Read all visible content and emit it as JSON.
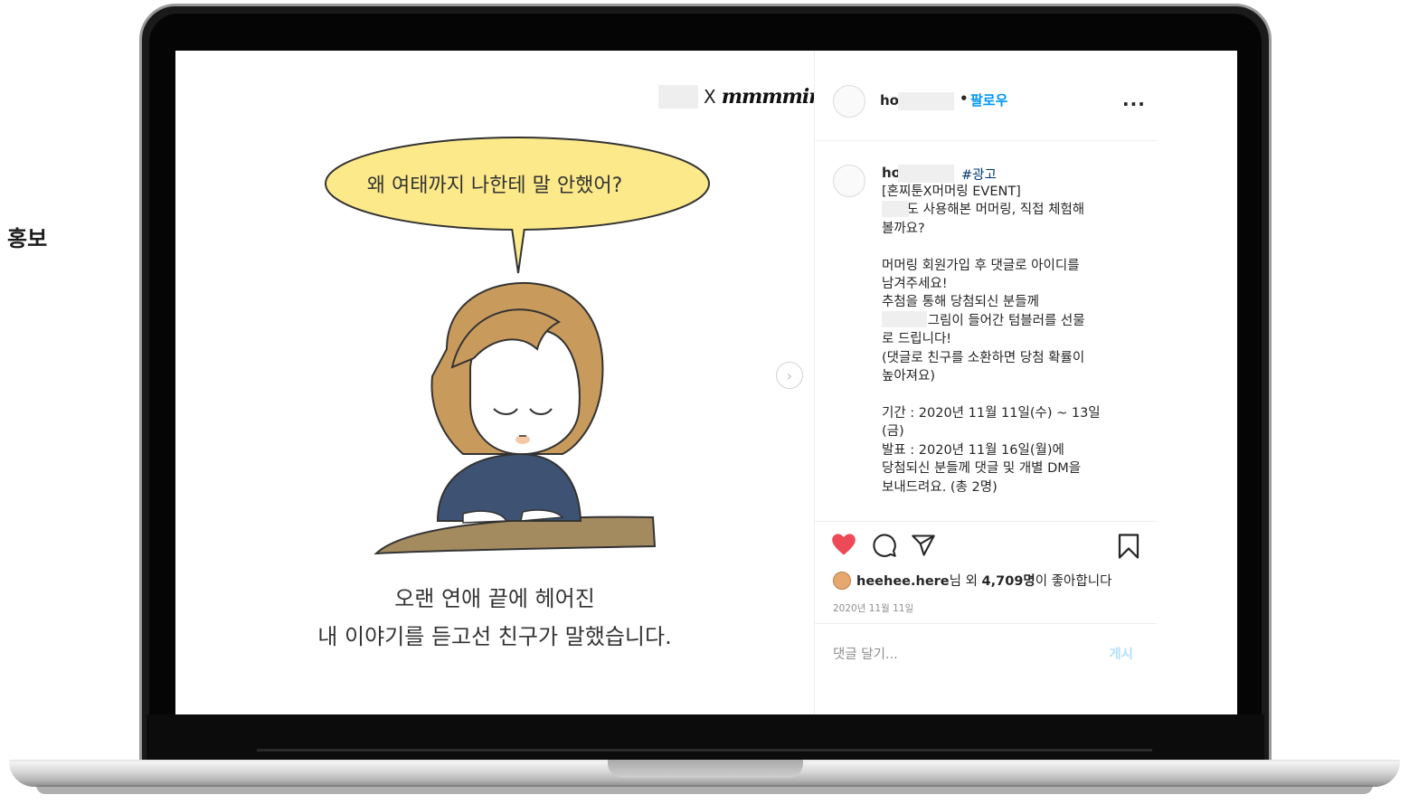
{
  "side_label": "홍보",
  "post": {
    "brand": {
      "x": "X",
      "logo_text": "mmmmino"
    },
    "image": {
      "speech_text": "왜 여태까지 나한테 말 안했어?",
      "caption_line_1": "오랜 연애 끝에 헤어진",
      "caption_line_2": "내 이야기를 듣고선 친구가 말했습니다."
    },
    "header": {
      "username_prefix": "ho",
      "dot": "•",
      "follow_label": "팔로우",
      "more_label": "..."
    },
    "comment": {
      "username_prefix": "ho",
      "hashtag": "#광고",
      "lines": [
        "[혼찌툰X머머링 EVENT]",
        "      도 사용해본 머머링, 직접 체험해",
        "볼까요?",
        "",
        "머머링 회원가입 후 댓글로 아이디를",
        "남겨주세요!",
        "추첨을 통해 당첨되신 분들께",
        "           그림이 들어간 텀블러를 선물",
        "로 드립니다!",
        "(댓글로 친구를 소환하면 당첨 확률이",
        "높아져요)",
        "",
        "기간 : 2020년 11월 11일(수) ~ 13일",
        "(금)",
        "발표 : 2020년 11월 16일(월)에",
        "당첨되신 분들께 댓글 및 개별 DM을",
        "보내드려요. (총 2명)"
      ]
    },
    "actions": {
      "liked_by_user": "heehee.here",
      "liked_by_suffix": "님 외",
      "likes_count": "4,709명",
      "likes_suffix": "이 좋아합니다",
      "date": "2020년 11월 11일",
      "comment_placeholder": "댓글 달기...",
      "post_label": "게시"
    }
  },
  "colors": {
    "like_red": "#ed4956",
    "follow_blue": "#0095f6",
    "post_disabled_blue": "#b2dffc",
    "speech_bubble": "#fbe98a",
    "hair": "#c89a5c",
    "sweater": "#3e5373",
    "table": "#a48a5f"
  },
  "icons": [
    "heart-icon",
    "comment-icon",
    "share-icon",
    "bookmark-icon",
    "chevron-right-icon",
    "more-icon"
  ]
}
